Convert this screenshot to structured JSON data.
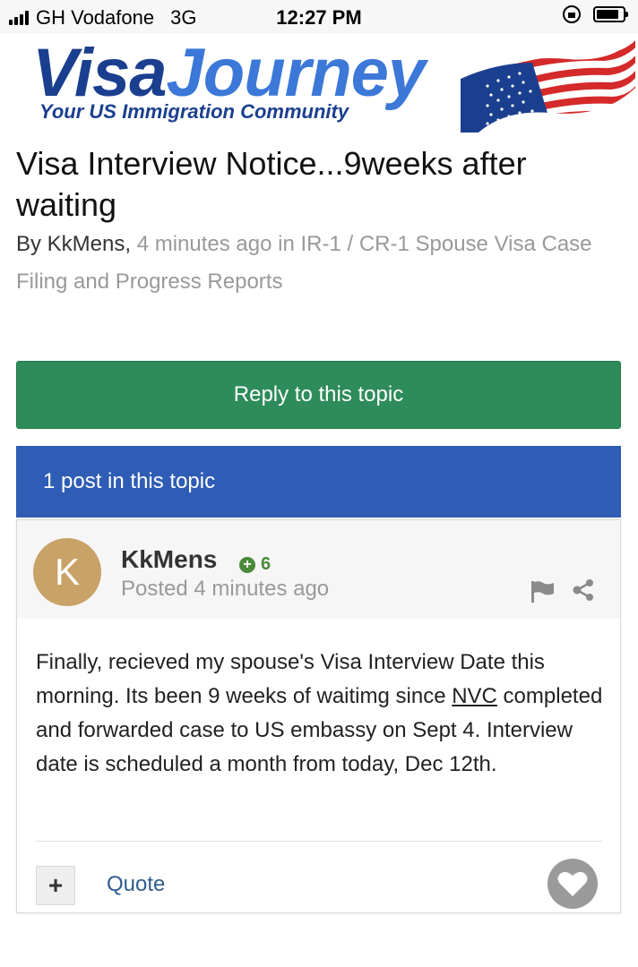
{
  "status_bar": {
    "carrier": "GH Vodafone",
    "network": "3G",
    "time": "12:27 PM"
  },
  "logo": {
    "word1": "Visa",
    "word2": "Journey",
    "tagline": "Your US Immigration Community"
  },
  "topic": {
    "title": "Visa Interview Notice...9weeks after waiting",
    "by_prefix": "By KkMens,",
    "meta": " 4 minutes ago in IR-1 / CR-1 Spouse Visa Case Filing and Progress Reports"
  },
  "reply_button": "Reply to this topic",
  "post_count": "1 post in this topic",
  "post": {
    "avatar_letter": "K",
    "author": "KkMens",
    "reputation": "6",
    "posted": "Posted 4 minutes ago",
    "body_part1": "Finally, recieved my spouse's Visa Interview Date this morning. Its been 9 weeks of waitimg since ",
    "body_link": "NVC",
    "body_part2": " completed and forwarded case to US embassy on Sept 4. Interview date is scheduled a month from today, Dec 12th.",
    "plus_label": "+",
    "quote_label": "Quote"
  },
  "icons": {
    "signal": "signal-bars-icon",
    "orientation_lock": "orientation-lock-icon",
    "battery": "battery-icon",
    "reputation": "plus-circle-icon",
    "report": "flag-icon",
    "share": "share-icon",
    "like": "heart-icon"
  },
  "colors": {
    "reply_green": "#2e8c5a",
    "posts_bar_blue": "#2f5cb5",
    "logo_dark_blue": "#1b3f8f",
    "logo_light_blue": "#3b78d8",
    "avatar": "#c9a268",
    "reputation_green": "#4a8a3a"
  }
}
